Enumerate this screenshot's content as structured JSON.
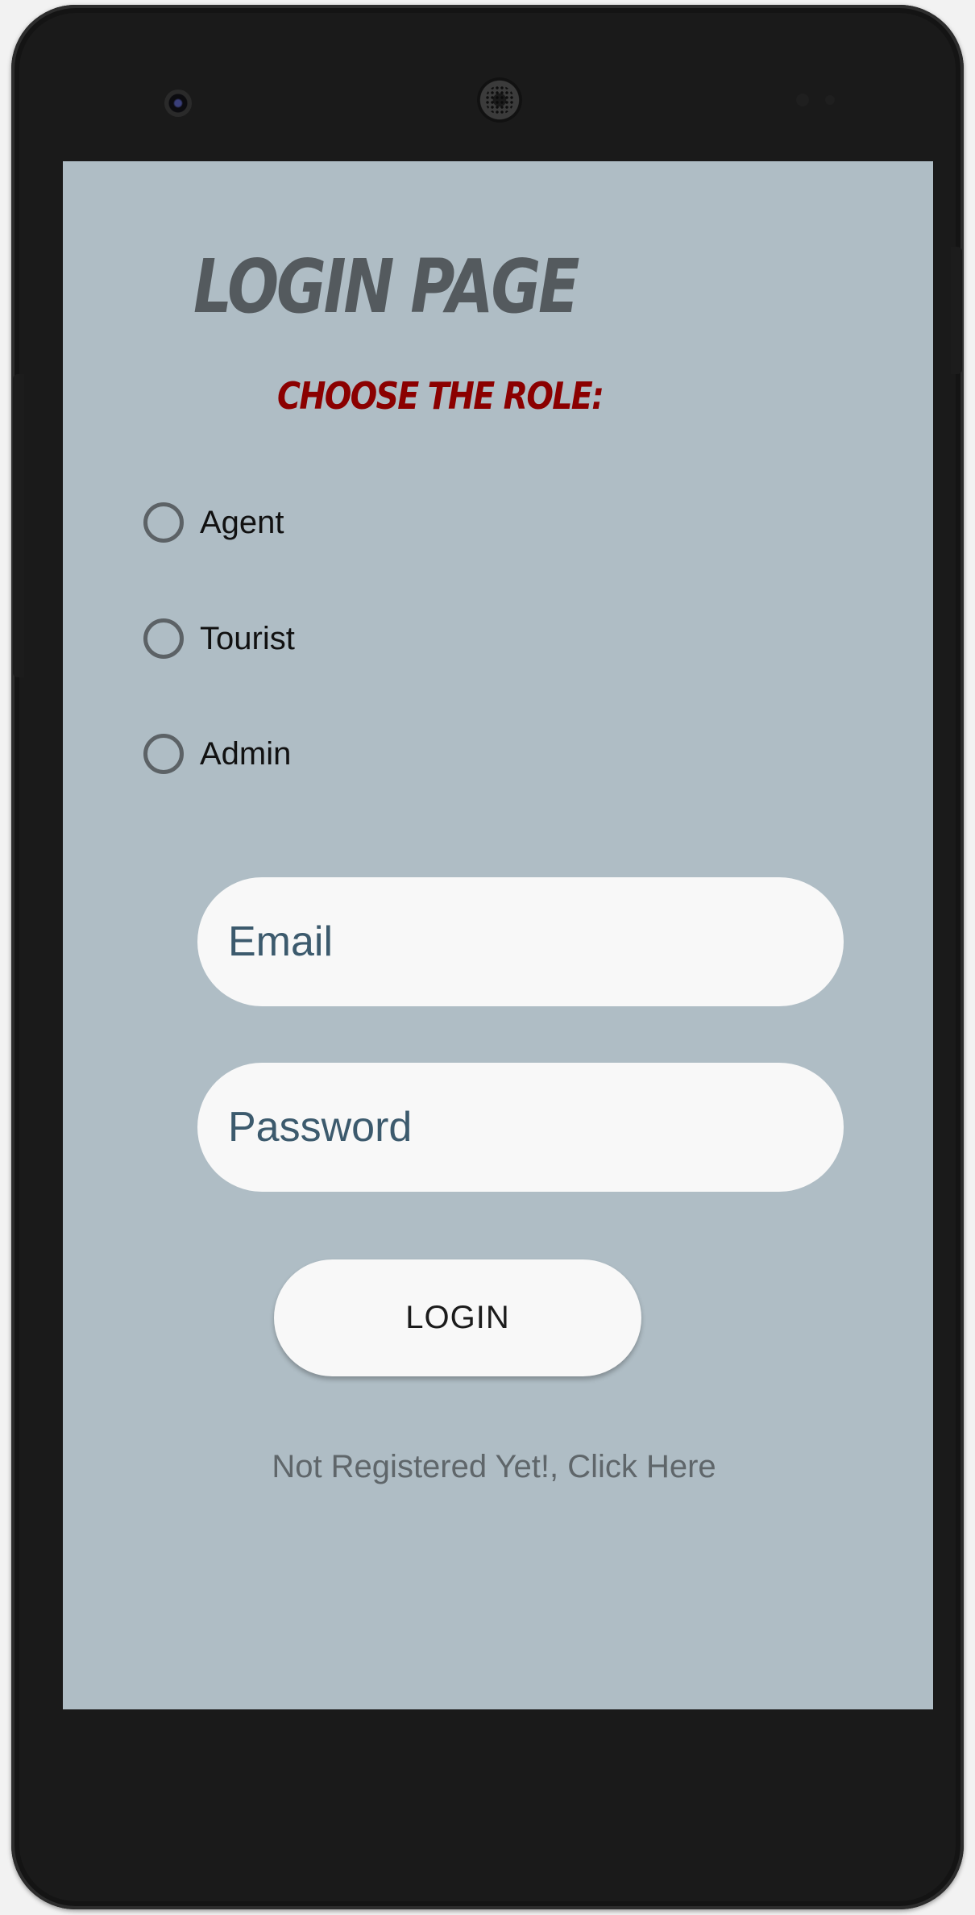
{
  "screen": {
    "title": "LOGIN PAGE",
    "role_heading": "CHOOSE THE ROLE:"
  },
  "roles": [
    {
      "label": "Agent",
      "selected": false
    },
    {
      "label": "Tourist",
      "selected": false
    },
    {
      "label": "Admin",
      "selected": false
    }
  ],
  "form": {
    "email_placeholder": "Email",
    "email_value": "",
    "password_placeholder": "Password",
    "password_value": "",
    "login_label": "LOGIN",
    "register_link": "Not Registered Yet!, Click Here"
  },
  "colors": {
    "screen_background": "#afbdc5",
    "title": "#545a5e",
    "role_heading": "#8b0000",
    "input_background": "#f8f8f8",
    "placeholder": "#3c5a6d"
  },
  "icons": {
    "radio": "radio-unchecked-icon",
    "camera": "front-camera-icon",
    "speaker": "earpiece-speaker-icon"
  }
}
